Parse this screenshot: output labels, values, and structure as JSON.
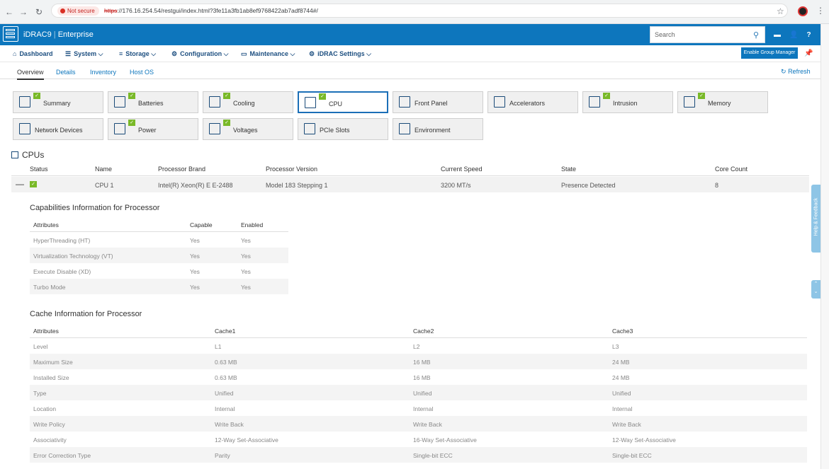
{
  "browser": {
    "secure_label": "Not secure",
    "url_https": "https",
    "url_rest": "://176.16.254.54/restgui/index.html?3fe11a3fb1ab8ef9768422ab7adf8744#/"
  },
  "header": {
    "product": "iDRAC9",
    "edition": "Enterprise",
    "search_placeholder": "Search"
  },
  "menu": {
    "dashboard": "Dashboard",
    "system": "System",
    "storage": "Storage",
    "configuration": "Configuration",
    "maintenance": "Maintenance",
    "idrac_settings": "iDRAC Settings",
    "group_manager": "Enable Group Manager"
  },
  "tabs": {
    "overview": "Overview",
    "details": "Details",
    "inventory": "Inventory",
    "host_os": "Host OS",
    "refresh": "Refresh"
  },
  "tiles": [
    {
      "label": "Summary"
    },
    {
      "label": "Batteries"
    },
    {
      "label": "Cooling"
    },
    {
      "label": "CPU"
    },
    {
      "label": "Front Panel"
    },
    {
      "label": "Accelerators"
    },
    {
      "label": "Intrusion"
    },
    {
      "label": "Memory"
    },
    {
      "label": "Network Devices"
    },
    {
      "label": "Power"
    },
    {
      "label": "Voltages"
    },
    {
      "label": "PCIe Slots"
    },
    {
      "label": "Environment"
    }
  ],
  "cpus": {
    "title": "CPUs",
    "headers": {
      "status": "Status",
      "name": "Name",
      "brand": "Processor Brand",
      "version": "Processor Version",
      "speed": "Current Speed",
      "state": "State",
      "cores": "Core Count"
    },
    "row": {
      "name": "CPU 1",
      "brand": "Intel(R) Xeon(R) E E-2488",
      "version": "Model 183 Stepping 1",
      "speed": "3200 MT/s",
      "state": "Presence Detected",
      "cores": "8"
    }
  },
  "capabilities": {
    "title": "Capabilities Information for Processor",
    "headers": [
      "Attributes",
      "Capable",
      "Enabled"
    ],
    "rows": [
      [
        "HyperThreading (HT)",
        "Yes",
        "Yes"
      ],
      [
        "Virtualization Technology (VT)",
        "Yes",
        "Yes"
      ],
      [
        "Execute Disable (XD)",
        "Yes",
        "Yes"
      ],
      [
        "Turbo Mode",
        "Yes",
        "Yes"
      ]
    ]
  },
  "cache": {
    "title": "Cache Information for Processor",
    "headers": [
      "Attributes",
      "Cache1",
      "Cache2",
      "Cache3"
    ],
    "rows": [
      [
        "Level",
        "L1",
        "L2",
        "L3"
      ],
      [
        "Maximum Size",
        "0.63 MB",
        "16 MB",
        "24 MB"
      ],
      [
        "Installed Size",
        "0.63 MB",
        "16 MB",
        "24 MB"
      ],
      [
        "Type",
        "Unified",
        "Unified",
        "Unified"
      ],
      [
        "Location",
        "Internal",
        "Internal",
        "Internal"
      ],
      [
        "Write Policy",
        "Write Back",
        "Write Back",
        "Write Back"
      ],
      [
        "Associativity",
        "12-Way Set-Associative",
        "16-Way Set-Associative",
        "12-Way Set-Associative"
      ],
      [
        "Error Correction Type",
        "Parity",
        "Single-bit ECC",
        "Single-bit ECC"
      ]
    ]
  },
  "side": {
    "help": "Help & Feedback"
  }
}
